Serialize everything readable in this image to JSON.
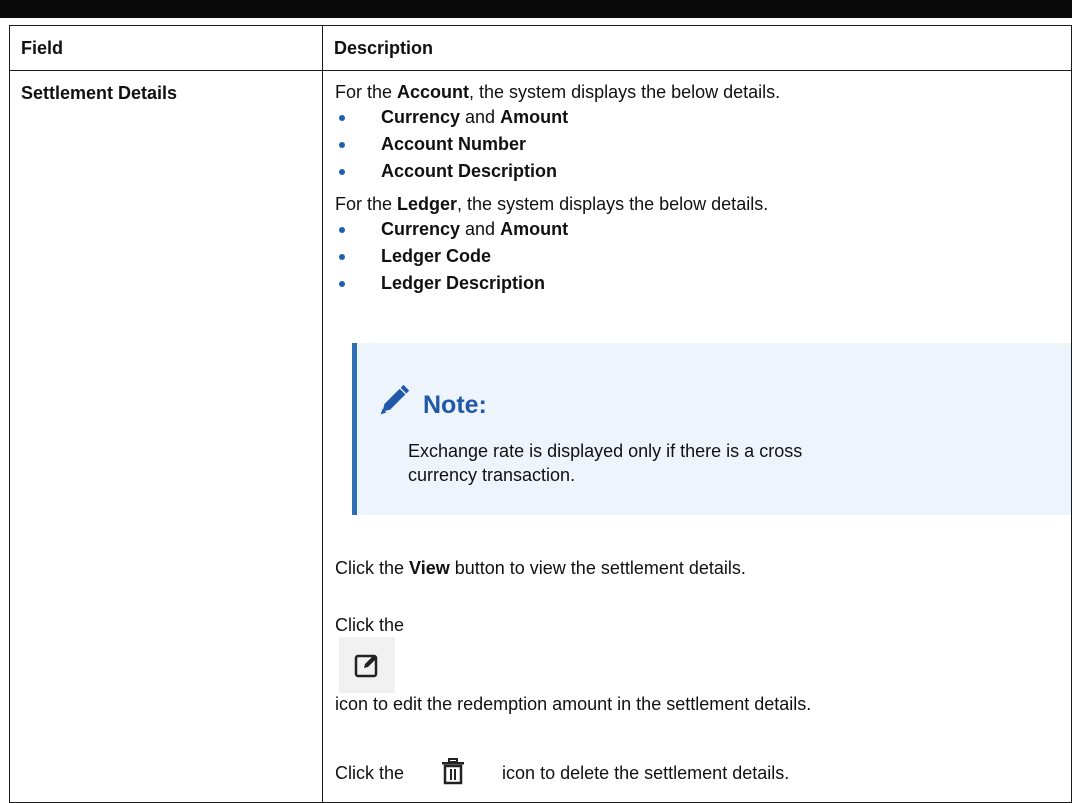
{
  "header": {
    "field": "Field",
    "description": "Description"
  },
  "row": {
    "field": "Settlement Details",
    "account_intro": {
      "pre": "For the ",
      "bold": "Account",
      "post": ", the system displays the below details."
    },
    "account_items": [
      {
        "b1": "Currency",
        "mid": " and ",
        "b2": "Amount"
      },
      {
        "b1": "Account Number",
        "mid": "",
        "b2": ""
      },
      {
        "b1": "Account Description",
        "mid": "",
        "b2": ""
      }
    ],
    "ledger_intro": {
      "pre": "For the ",
      "bold": "Ledger",
      "post": ", the system displays the below details."
    },
    "ledger_items": [
      {
        "b1": "Currency",
        "mid": " and ",
        "b2": "Amount"
      },
      {
        "b1": "Ledger Code",
        "mid": "",
        "b2": ""
      },
      {
        "b1": "Ledger Description",
        "mid": "",
        "b2": ""
      }
    ],
    "note": {
      "title": "Note:",
      "body": "Exchange rate is displayed only if there is a cross currency transaction.",
      "icon": "pencil-icon"
    },
    "view_line": {
      "pre": "Click the ",
      "bold": "View",
      "post": " button to view the settlement details."
    },
    "edit_line": {
      "pre": "Click the",
      "post": " icon to edit the redemption amount in the settlement details.",
      "icon": "edit-icon"
    },
    "delete_line": {
      "pre": "Click the",
      "post": " icon to delete the settlement details.",
      "icon": "trash-icon"
    }
  },
  "colors": {
    "accent": "#2158a8",
    "note_bg": "#eef4fb",
    "bullet": "#1f5fb3"
  }
}
